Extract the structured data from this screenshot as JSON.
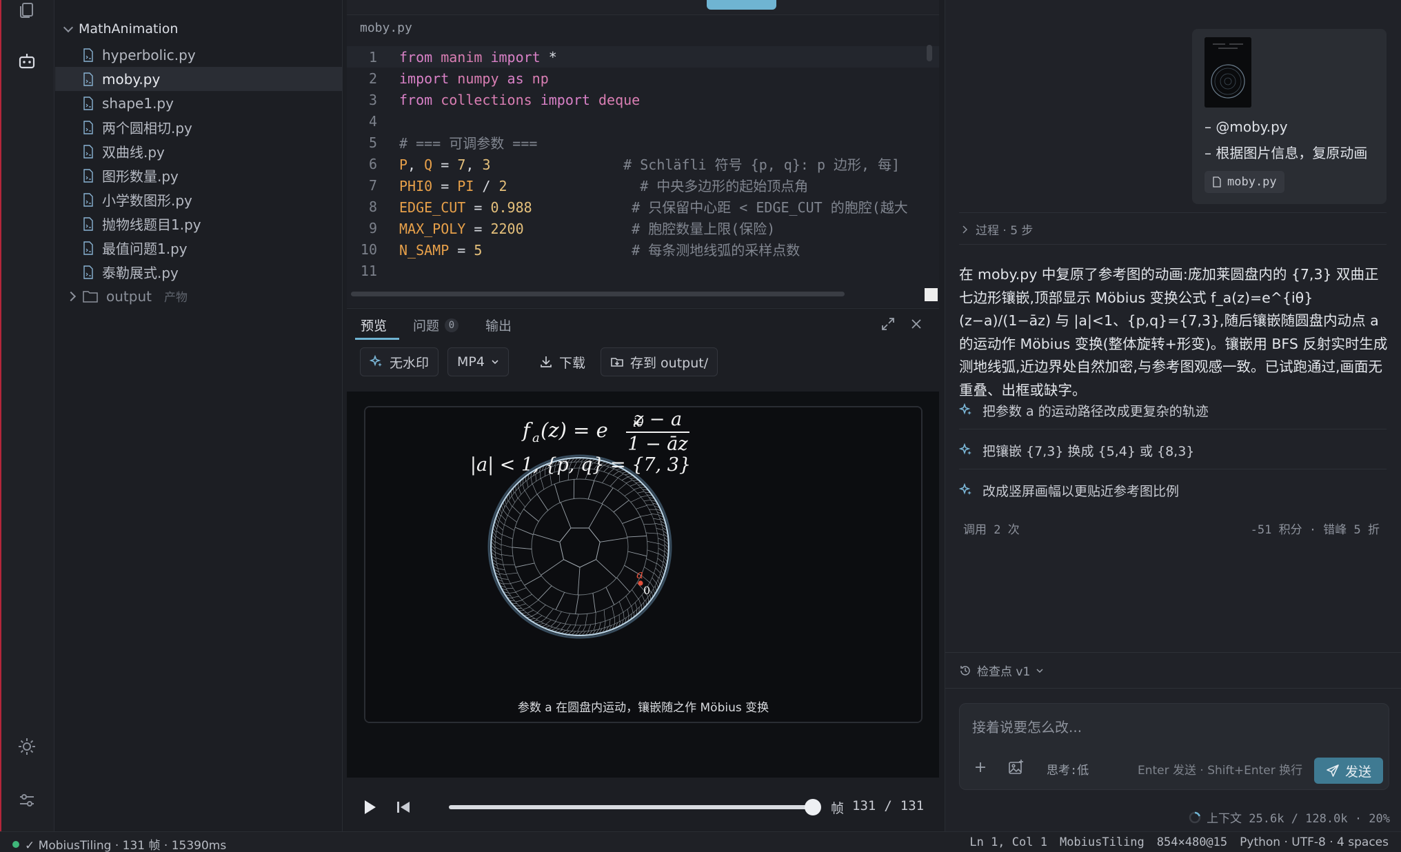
{
  "explorer": {
    "root_folder": "MathAnimation",
    "files": [
      {
        "name": "hyperbolic.py",
        "active": false
      },
      {
        "name": "moby.py",
        "active": true
      },
      {
        "name": "shape1.py",
        "active": false
      },
      {
        "name": "两个圆相切.py",
        "active": false
      },
      {
        "name": "双曲线.py",
        "active": false
      },
      {
        "name": "图形数量.py",
        "active": false
      },
      {
        "name": "小学数图形.py",
        "active": false
      },
      {
        "name": "抛物线题目1.py",
        "active": false
      },
      {
        "name": "最值问题1.py",
        "active": false
      },
      {
        "name": "泰勒展式.py",
        "active": false
      }
    ],
    "output_folder": "output",
    "output_tag": "产物"
  },
  "editor": {
    "breadcrumb": "moby.py",
    "line_numbers": [
      "1",
      "2",
      "3",
      "4",
      "5",
      "6",
      "7",
      "8",
      "9",
      "10",
      "11"
    ],
    "lines": [
      [
        {
          "t": "from",
          "c": "kw"
        },
        {
          "t": " manim ",
          "c": "mod"
        },
        {
          "t": "import",
          "c": "kw"
        },
        {
          "t": " *",
          "c": "op"
        }
      ],
      [
        {
          "t": "import",
          "c": "kw"
        },
        {
          "t": " numpy ",
          "c": "mod"
        },
        {
          "t": "as",
          "c": "kw"
        },
        {
          "t": " np",
          "c": "mod"
        }
      ],
      [
        {
          "t": "from",
          "c": "kw"
        },
        {
          "t": " collections ",
          "c": "mod"
        },
        {
          "t": "import",
          "c": "kw"
        },
        {
          "t": " deque",
          "c": "mod"
        }
      ],
      [],
      [
        {
          "t": "# === 可调参数 ===",
          "c": "cm"
        }
      ],
      [
        {
          "t": "P",
          "c": "cn"
        },
        {
          "t": ", ",
          "c": "op"
        },
        {
          "t": "Q",
          "c": "cn"
        },
        {
          "t": " = ",
          "c": "op"
        },
        {
          "t": "7",
          "c": "num"
        },
        {
          "t": ", ",
          "c": "op"
        },
        {
          "t": "3",
          "c": "num"
        },
        {
          "t": "                # Schläfli 符号 {p, q}: p 边形, 每]",
          "c": "cm"
        }
      ],
      [
        {
          "t": "PHI0",
          "c": "cn"
        },
        {
          "t": " = ",
          "c": "op"
        },
        {
          "t": "PI",
          "c": "cn"
        },
        {
          "t": " / ",
          "c": "op"
        },
        {
          "t": "2",
          "c": "num"
        },
        {
          "t": "                # 中央多边形的起始顶点角",
          "c": "cm"
        }
      ],
      [
        {
          "t": "EDGE_CUT",
          "c": "cn"
        },
        {
          "t": " = ",
          "c": "op"
        },
        {
          "t": "0.988",
          "c": "num"
        },
        {
          "t": "            # 只保留中心距 < EDGE_CUT 的胞腔(越大",
          "c": "cm"
        }
      ],
      [
        {
          "t": "MAX_POLY",
          "c": "cn"
        },
        {
          "t": " = ",
          "c": "op"
        },
        {
          "t": "2200",
          "c": "num"
        },
        {
          "t": "             # 胞腔数量上限(保险)",
          "c": "cm"
        }
      ],
      [
        {
          "t": "N_SAMP",
          "c": "cn"
        },
        {
          "t": " = ",
          "c": "op"
        },
        {
          "t": "5",
          "c": "num"
        },
        {
          "t": "                  # 每条测地线弧的采样点数",
          "c": "cm"
        }
      ],
      []
    ]
  },
  "panel": {
    "tabs": {
      "preview": "预览",
      "problems": "问题",
      "problems_count": "0",
      "output": "输出"
    },
    "toolbar": {
      "watermark": "无水印",
      "format": "MP4",
      "download": "下载",
      "save": "存到 output/"
    },
    "video": {
      "formula_lhs": "f",
      "formula_sub": "a",
      "formula_mid": "(z) = e",
      "formula_exp": "iθ",
      "formula_num": "z − a",
      "formula_den": "1 − āz",
      "condition": "|a| < 1,   {p, q} = {7, 3}",
      "point_a": "a",
      "point_0": "0",
      "caption": "参数 a 在圆盘内运动，镶嵌随之作 Möbius 变换"
    },
    "player": {
      "frame_label": "帧",
      "frame_current": "131",
      "frame_sep": "/",
      "frame_total": "131",
      "progress": 1.0
    }
  },
  "chat": {
    "user_lines": [
      "– @moby.py",
      "– 根据图片信息，复原动画"
    ],
    "user_file_chip": "moby.py",
    "process": "过程 · 5 步",
    "answer": "在 moby.py 中复原了参考图的动画:庞加莱圆盘内的 {7,3} 双曲正七边形镶嵌,顶部显示 Möbius 变换公式 f_a(z)=e^{iθ}(z−a)/(1−āz) 与 |a|<1、{p,q}={7,3},随后镶嵌随圆盘内动点 a 的运动作 Möbius 变换(整体旋转+形变)。镶嵌用 BFS 反射实时生成测地线弧,近边界处自然加密,与参考图观感一致。已试跑通过,画面无重叠、出框或缺字。",
    "suggestions": [
      "把参数 a 的运动路径改成更复杂的轨迹",
      "把镶嵌 {7,3} 换成 {5,4} 或 {8,3}",
      "改成竖屏画幅以更贴近参考图比例"
    ],
    "usage_left": "调用 2 次",
    "usage_right": "-51 积分 · 错峰 5 折",
    "checkpoint": "检查点 v1",
    "composer_placeholder": "接着说要怎么改...",
    "thinking": "思考:低",
    "hint": "Enter 发送 · Shift+Enter 换行",
    "send": "发送",
    "context": "上下文 25.6k / 128.0k · 20%"
  },
  "statusbar": {
    "left": "✓ MobiusTiling · 131 帧 · 15390ms",
    "position": "Ln 1, Col 1",
    "scene": "MobiusTiling",
    "resolution": "854×480@15",
    "language": "Python · UTF-8 · 4 spaces"
  },
  "colors": {
    "accent": "#6fb4d2",
    "send_button": "#3f7a92",
    "ok_dot": "#3fb77a"
  }
}
